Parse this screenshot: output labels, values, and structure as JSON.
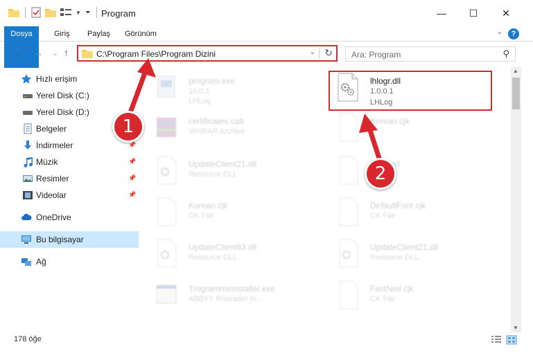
{
  "window": {
    "title": "Program",
    "minimize": "—",
    "maximize": "☐",
    "close": "✕"
  },
  "ribbon": {
    "tabs": [
      "Dosya",
      "Giriş",
      "Paylaş",
      "Görünüm"
    ],
    "help": "?"
  },
  "nav": {
    "address": "C:\\Program Files\\Program Dizini",
    "search_placeholder": "Ara: Program"
  },
  "sidebar": {
    "items": [
      {
        "label": "Hızlı erişim",
        "icon": "star-icon"
      },
      {
        "label": "Yerel Disk (C:)",
        "icon": "drive-icon"
      },
      {
        "label": "Yerel Disk (D:)",
        "icon": "drive-icon"
      },
      {
        "label": "Belgeler",
        "icon": "document-icon"
      },
      {
        "label": "İndirmeler",
        "icon": "download-icon"
      },
      {
        "label": "Müzik",
        "icon": "music-icon"
      },
      {
        "label": "Resimler",
        "icon": "picture-icon"
      },
      {
        "label": "Videolar",
        "icon": "video-icon"
      },
      {
        "label": "OneDrive",
        "icon": "cloud-icon"
      },
      {
        "label": "Bu bilgisayar",
        "icon": "computer-icon"
      },
      {
        "label": "Ağ",
        "icon": "network-icon"
      }
    ]
  },
  "files": [
    {
      "name": "program.exe",
      "line1": "10.0.1",
      "line2": "LHLog"
    },
    {
      "name": "lhlogr.dll",
      "line1": "1.0.0.1",
      "line2": "LHLog"
    },
    {
      "name": "certificates.cab",
      "line1": "WinRAR Archive",
      "line2": ""
    },
    {
      "name": "Korean.cjk",
      "line1": "",
      "line2": ""
    },
    {
      "name": "UpdateClient21.dll",
      "line1": "Resource DLL",
      "line2": ""
    },
    {
      "name": "Archivid",
      "line1": "",
      "line2": ""
    },
    {
      "name": "Korean.cjk",
      "line1": "CK File",
      "line2": ""
    },
    {
      "name": "DefaultFont.cjk",
      "line1": "CK File",
      "line2": ""
    },
    {
      "name": "UpdateClient63.dll",
      "line1": "Resource DLL",
      "line2": ""
    },
    {
      "name": "UpdateClient21.dll",
      "line1": "Resource DLL",
      "line2": ""
    },
    {
      "name": "TrogrammsInstaller.exe",
      "line1": "ABBYY Rreeader tri...",
      "line2": ""
    },
    {
      "name": "FastNml.cjk",
      "line1": "CK File",
      "line2": ""
    }
  ],
  "status": {
    "count": "178 öğe"
  },
  "annotations": {
    "badge1": "1",
    "badge2": "2"
  },
  "colors": {
    "accent": "#1979ca",
    "highlight": "#d9272e",
    "selection": "#cce8ff"
  }
}
